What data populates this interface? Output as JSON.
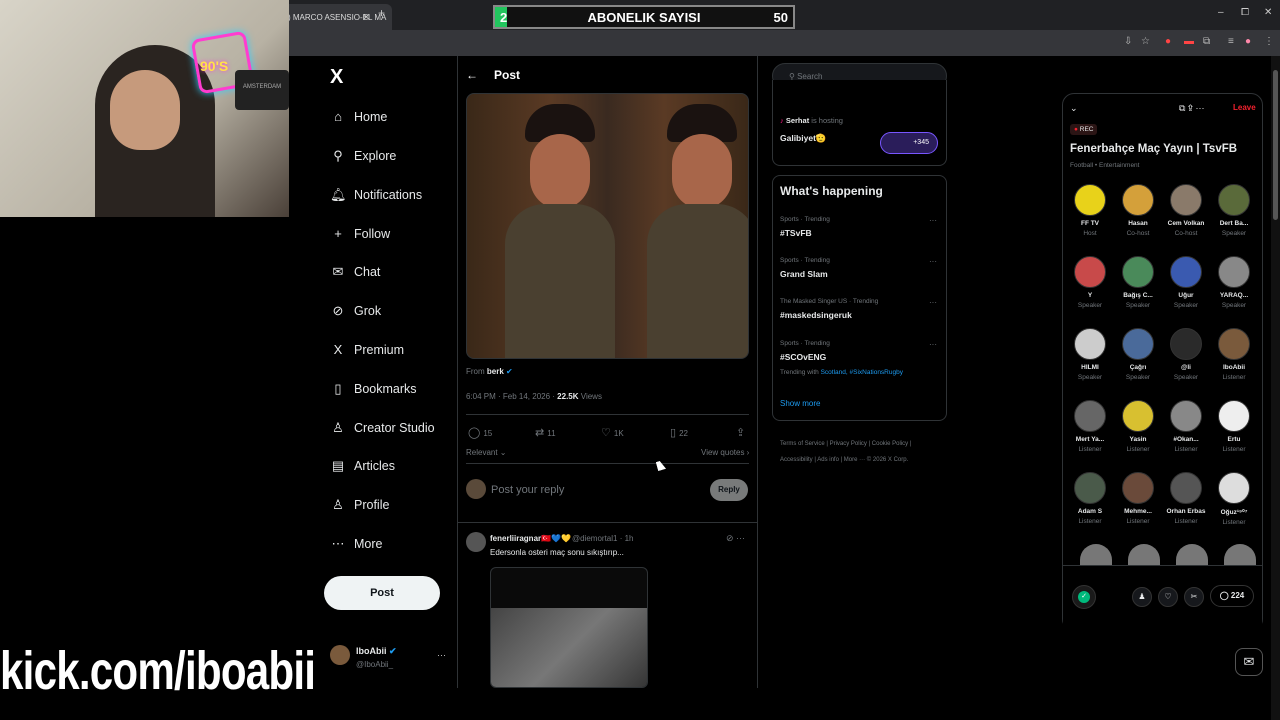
{
  "browser": {
    "tab_title": ") MARCO ASENSIO-EL MA",
    "tab_close": "✕",
    "new_tab": "+",
    "win_min": "–",
    "win_max": "⧠",
    "win_close": "✕"
  },
  "overlay": {
    "subgoal_current": "2",
    "subgoal_label": "ABONELIK SAYISI",
    "subgoal_target": "50",
    "subgoal_progress": 0.04,
    "kick_url": "kick.com/iboabii",
    "neon_text": "90'S",
    "cam_sign": "AMSTERDAM"
  },
  "sidebar": {
    "logo": "X",
    "items": [
      {
        "icon": "home-icon",
        "glyph": "⌂",
        "label": "Home"
      },
      {
        "icon": "search-icon",
        "glyph": "⚲",
        "label": "Explore"
      },
      {
        "icon": "bell-icon",
        "glyph": "🔔︎",
        "label": "Notifications"
      },
      {
        "icon": "follow-icon",
        "glyph": "+",
        "label": "Follow"
      },
      {
        "icon": "chat-icon",
        "glyph": "✉",
        "label": "Chat"
      },
      {
        "icon": "grok-icon",
        "glyph": "⊘",
        "label": "Grok"
      },
      {
        "icon": "x-premium-icon",
        "glyph": "X",
        "label": "Premium"
      },
      {
        "icon": "bookmark-icon",
        "glyph": "▯",
        "label": "Bookmarks"
      },
      {
        "icon": "creator-studio-icon",
        "glyph": "♙",
        "label": "Creator Studio"
      },
      {
        "icon": "articles-icon",
        "glyph": "▤",
        "label": "Articles"
      },
      {
        "icon": "profile-icon",
        "glyph": "♙",
        "label": "Profile"
      },
      {
        "icon": "more-icon",
        "glyph": "⋯",
        "label": "More"
      }
    ],
    "post_label": "Post",
    "me_name": "IboAbii",
    "me_handle": "@IboAbii_",
    "me_more": "···"
  },
  "post": {
    "header_back": "←",
    "header_title": "Post",
    "from_label": "From",
    "from_name": "berk",
    "time": "6:04 PM · Feb 14, 2026 ·",
    "views_count": "22.5K",
    "views_label": "Views",
    "replies": "15",
    "reposts": "11",
    "likes": "1K",
    "bookmarks": "22",
    "relevant": "Relevant",
    "view_quotes": "View quotes",
    "reply_placeholder": "Post your reply",
    "reply_button": "Reply"
  },
  "comment": {
    "name": "fenerliiragnar🇹🇷💙💛",
    "handle": "@diemortal1 · 1h",
    "text": "Edersonla osteri maç sonu sıkıştırıp..."
  },
  "right": {
    "search_placeholder": "Search",
    "host_name": "Serhat",
    "host_suffix": "is hosting",
    "host_title": "Galibiyet🫡",
    "host_count": "+345",
    "whats_happening": "What's happening",
    "trends": [
      {
        "meta": "Sports · Trending",
        "name": "#TSvFB"
      },
      {
        "meta": "Sports · Trending",
        "name": "Grand Slam"
      },
      {
        "meta": "The Masked Singer US · Trending",
        "name": "#maskedsingeruk"
      },
      {
        "meta": "Sports · Trending",
        "name": "#SCOvENG"
      }
    ],
    "trending_with_prefix": "Trending with",
    "trending_with_tags": "Scotland, #SixNationsRugby",
    "show_more": "Show more",
    "footer": "Terms of Service  |  Privacy Policy  |  Cookie Policy  |  Accessibility  |  Ads info  |  More ···  © 2026 X Corp."
  },
  "space": {
    "rec_label": "REC",
    "title": "Fenerbahçe Maç Yayın | TsvFB",
    "subtitle": "Football • Entertainment",
    "leave": "Leave",
    "count": "224",
    "users": [
      {
        "name": "FF TV",
        "role": "Host",
        "color": "#e8d21a"
      },
      {
        "name": "Hasan",
        "role": "Co-host",
        "color": "#d4a03a"
      },
      {
        "name": "Cem Volkan",
        "role": "Co-host",
        "color": "#8a7a6a"
      },
      {
        "name": "Dert Ba...",
        "role": "Speaker",
        "color": "#5a6a3a"
      },
      {
        "name": "Y",
        "role": "Speaker",
        "color": "#c84a4a"
      },
      {
        "name": "Bağış C...",
        "role": "Speaker",
        "color": "#4a8a5a"
      },
      {
        "name": "Uğur",
        "role": "Speaker",
        "color": "#3a5ab0"
      },
      {
        "name": "YARAQ...",
        "role": "Speaker",
        "color": "#888"
      },
      {
        "name": "HILMI",
        "role": "Speaker",
        "color": "#ccc"
      },
      {
        "name": "Çağrı",
        "role": "Speaker",
        "color": "#4a6a9a"
      },
      {
        "name": "@li",
        "role": "Speaker",
        "color": "#2a2a2a"
      },
      {
        "name": "IboAbii",
        "role": "Listener",
        "color": "#7a5a3c"
      },
      {
        "name": "Mert Ya...",
        "role": "Listener",
        "color": "#666"
      },
      {
        "name": "Yasin",
        "role": "Listener",
        "color": "#d8c030"
      },
      {
        "name": "#Okan...",
        "role": "Listener",
        "color": "#888"
      },
      {
        "name": "Ertu",
        "role": "Listener",
        "color": "#eee"
      },
      {
        "name": "Adam S",
        "role": "Listener",
        "color": "#4a5a4a"
      },
      {
        "name": "Mehme...",
        "role": "Listener",
        "color": "#6a4a3a"
      },
      {
        "name": "Orhan Erbas",
        "role": "Listener",
        "color": "#555"
      },
      {
        "name": "Oğuz¹⁹⁰⁷",
        "role": "Listener",
        "color": "#ddd"
      }
    ]
  }
}
